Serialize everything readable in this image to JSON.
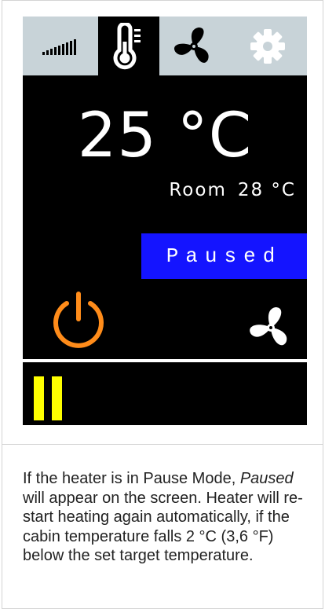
{
  "tabs": [
    {
      "id": "signal",
      "icon": "signal-strength-icon",
      "active": false
    },
    {
      "id": "temperature",
      "icon": "thermometer-icon",
      "active": true
    },
    {
      "id": "fan",
      "icon": "fan-icon",
      "active": false
    },
    {
      "id": "settings",
      "icon": "gear-icon",
      "active": false
    }
  ],
  "display": {
    "set_temperature": "25 °C",
    "room_label": "Room",
    "room_temperature": "28 °C",
    "status": "Paused"
  },
  "controls": {
    "power_icon": "power-icon",
    "fan_icon": "fan-icon",
    "pause_icon": "pause-icon"
  },
  "caption": {
    "before": "If the heater is in Pause Mode, ",
    "emphasis": "Paused",
    "after": " will appear on the screen. Heater will re-start heating again automatically, if the cabin temperature falls 2 °C (3,6 °F) below the set target temperature."
  },
  "colors": {
    "screen_bg": "#000000",
    "tab_inactive_bg": "#c8d3d8",
    "status_bg": "#1414ff",
    "power_orange": "#ff8c1a",
    "pause_yellow": "#ffff00"
  }
}
